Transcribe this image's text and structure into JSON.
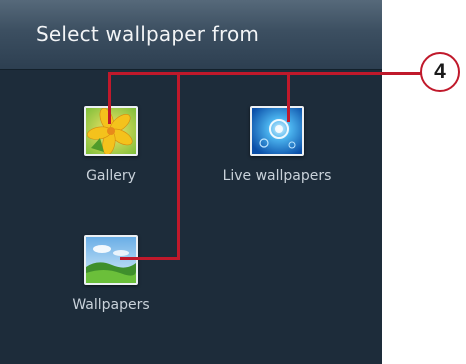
{
  "dialog": {
    "title": "Select wallpaper from",
    "options": [
      {
        "label": "Gallery",
        "icon": "gallery-flower-icon"
      },
      {
        "label": "Live wallpapers",
        "icon": "live-wallpaper-bubble-icon"
      },
      {
        "label": "Wallpapers",
        "icon": "wallpapers-landscape-icon"
      }
    ]
  },
  "callout": {
    "number": "4",
    "color": "#c0192b"
  }
}
